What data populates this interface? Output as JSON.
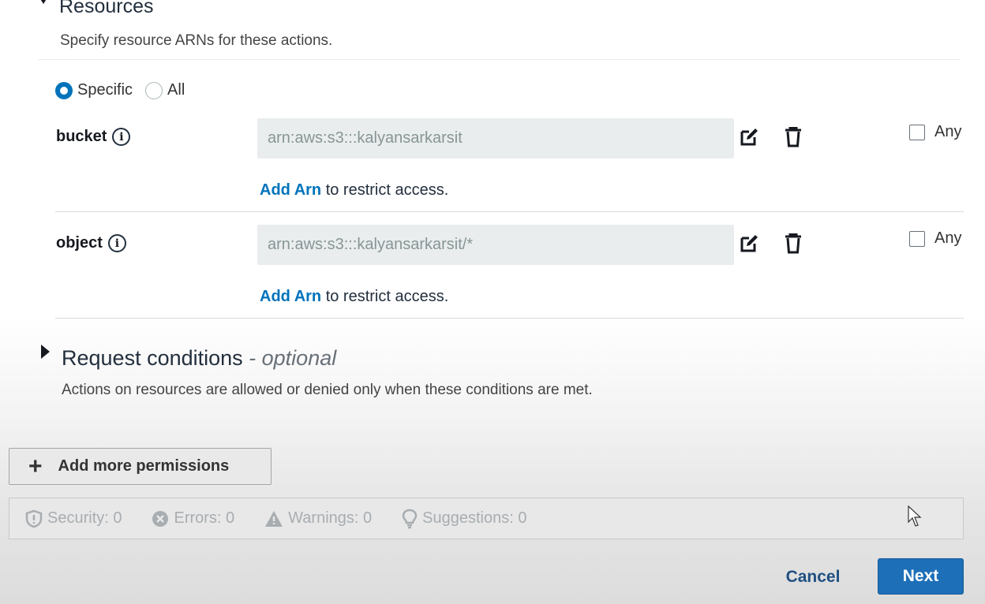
{
  "resources": {
    "title": "Resources",
    "description": "Specify resource ARNs for these actions.",
    "radio": {
      "specific_label": "Specific",
      "all_label": "All",
      "selected": "Specific"
    },
    "rows": [
      {
        "label": "bucket",
        "arn": "arn:aws:s3:::kalyansarkarsit",
        "any_label": "Any",
        "add_arn_link": "Add Arn",
        "add_arn_text": " to restrict access."
      },
      {
        "label": "object",
        "arn": "arn:aws:s3:::kalyansarkarsit/*",
        "any_label": "Any",
        "add_arn_link": "Add Arn",
        "add_arn_text": " to restrict access."
      }
    ]
  },
  "request_conditions": {
    "title": "Request conditions",
    "optional": " - optional",
    "description": "Actions on resources are allowed or denied only when these conditions are met."
  },
  "add_permissions_label": "Add more permissions",
  "status": {
    "security": "Security: 0",
    "errors": "Errors: 0",
    "warnings": "Warnings: 0",
    "suggestions": "Suggestions: 0"
  },
  "footer": {
    "cancel_label": "Cancel",
    "next_label": "Next"
  },
  "colors": {
    "link": "#0073bb",
    "primary": "#1d6fb8",
    "radio": "#0073bb"
  },
  "icons": [
    "info-icon",
    "edit-icon",
    "trash-icon",
    "shield-icon",
    "error-icon",
    "warning-icon",
    "lightbulb-icon",
    "plus-icon",
    "cursor-icon"
  ]
}
